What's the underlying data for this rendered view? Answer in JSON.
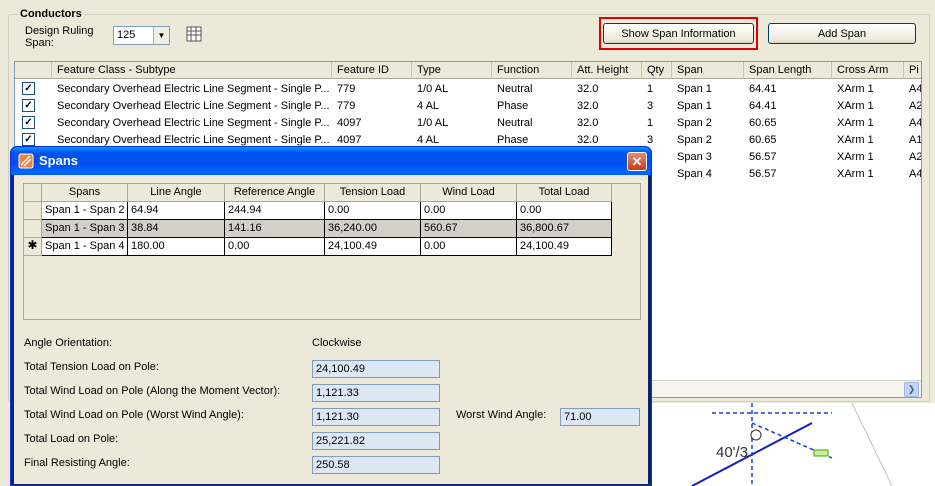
{
  "conductors": {
    "group_label": "Conductors",
    "design_ruling_span_label": "Design Ruling Span:",
    "design_ruling_span_value": "125",
    "show_span_button": "Show Span Information",
    "add_span_button": "Add Span",
    "columns": [
      "Feature Class - Subtype",
      "Feature ID",
      "Type",
      "Function",
      "Att. Height",
      "Qty",
      "Span",
      "Span Length",
      "Cross Arm",
      "Pi"
    ],
    "rows": [
      {
        "checked": true,
        "cells": [
          "Secondary Overhead Electric Line Segment - Single P...",
          "779",
          "1/0 AL",
          "Neutral",
          "32.0",
          "1",
          "Span 1",
          "64.41",
          "XArm 1",
          "A4"
        ]
      },
      {
        "checked": true,
        "cells": [
          "Secondary Overhead Electric Line Segment - Single P...",
          "779",
          "4 AL",
          "Phase",
          "32.0",
          "3",
          "Span 1",
          "64.41",
          "XArm 1",
          "A2"
        ]
      },
      {
        "checked": true,
        "cells": [
          "Secondary Overhead Electric Line Segment - Single P...",
          "4097",
          "1/0 AL",
          "Neutral",
          "32.0",
          "1",
          "Span 2",
          "60.65",
          "XArm 1",
          "A4"
        ]
      },
      {
        "checked": true,
        "cells": [
          "Secondary Overhead Electric Line Segment - Single P...",
          "4097",
          "4 AL",
          "Phase",
          "32.0",
          "3",
          "Span 2",
          "60.65",
          "XArm 1",
          "A1"
        ]
      },
      {
        "checked": false,
        "cells": [
          "",
          "",
          "",
          "",
          "",
          "",
          "Span 3",
          "56.57",
          "XArm 1",
          "A2"
        ]
      },
      {
        "checked": false,
        "cells": [
          "",
          "",
          "",
          "",
          "",
          "",
          "Span 4",
          "56.57",
          "XArm 1",
          "A4"
        ]
      }
    ]
  },
  "map": {
    "label": "40'/3"
  },
  "spans_dialog": {
    "title": "Spans",
    "close_glyph": "✕",
    "columns": [
      "Spans",
      "Line Angle",
      "Reference Angle",
      "Tension Load",
      "Wind Load",
      "Total Load"
    ],
    "rows": [
      {
        "marker": "",
        "cells": [
          "Span 1 - Span 2",
          "64.94",
          "244.94",
          "0.00",
          "0.00",
          "0.00"
        ]
      },
      {
        "marker": "",
        "cells": [
          "Span 1 - Span 3",
          "38.84",
          "141.16",
          "36,240.00",
          "560.67",
          "36,800.67"
        ]
      },
      {
        "marker": "✱",
        "cells": [
          "Span 1 - Span 4",
          "180.00",
          "0.00",
          "24,100.49",
          "0.00",
          "24,100.49"
        ]
      }
    ],
    "angle_orientation_label": "Angle Orientation:",
    "angle_orientation_value": "Clockwise",
    "total_tension_label": "Total Tension Load on Pole:",
    "total_tension_value": "24,100.49",
    "total_wind_moment_label": "Total Wind Load on Pole (Along the Moment Vector):",
    "total_wind_moment_value": "1,121.33",
    "total_wind_worst_label": "Total Wind Load on Pole (Worst Wind Angle):",
    "total_wind_worst_value": "1,121.30",
    "worst_wind_angle_label": "Worst Wind Angle:",
    "worst_wind_angle_value": "71.00",
    "total_load_label": "Total Load on Pole:",
    "total_load_value": "25,221.82",
    "final_resisting_label": "Final Resisting Angle:",
    "final_resisting_value": "250.58"
  }
}
